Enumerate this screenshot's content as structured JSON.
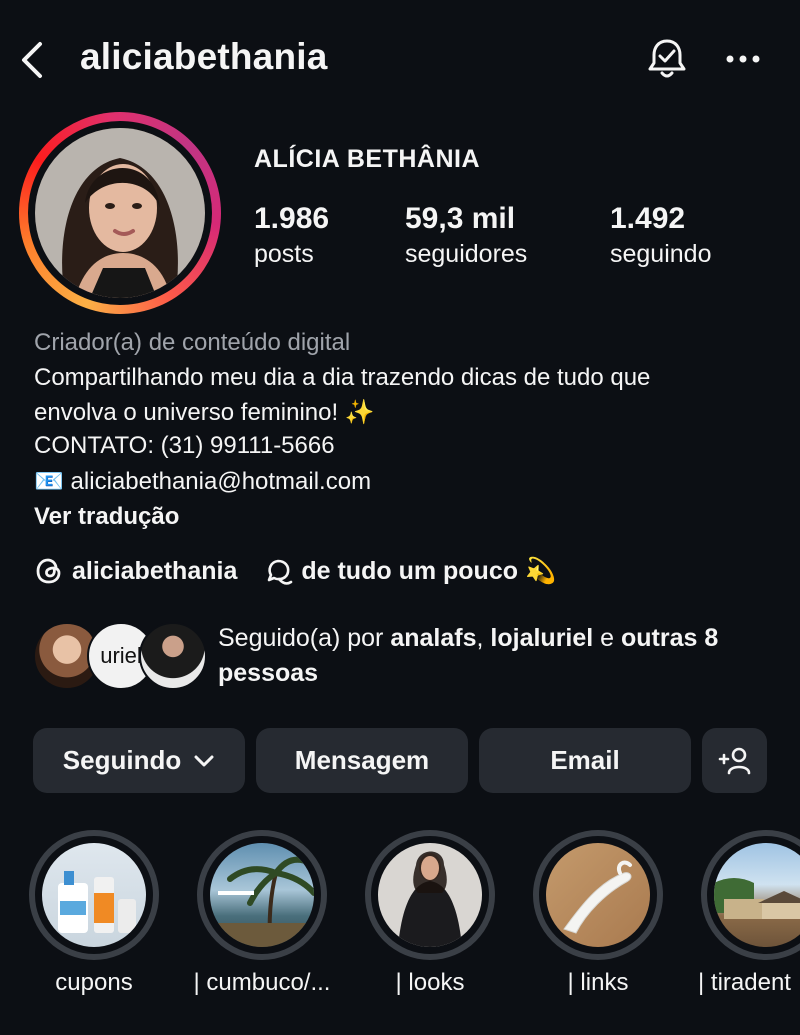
{
  "header": {
    "username": "aliciabethania"
  },
  "profile": {
    "full_name": "ALÍCIA BETHÂNIA",
    "stats": [
      {
        "value": "1.986",
        "label": "posts"
      },
      {
        "value": "59,3 mil",
        "label": "seguidores"
      },
      {
        "value": "1.492",
        "label": "seguindo"
      }
    ]
  },
  "bio": {
    "category": "Criador(a) de conteúdo digital",
    "line1": "Compartilhando meu dia a dia trazendo dicas de tudo que",
    "line2": "envolva o universo feminino! ✨",
    "line3": "CONTATO: (31) 99111-5666",
    "line4": "📧 aliciabethania@hotmail.com",
    "translate": "Ver tradução"
  },
  "links": {
    "threads_handle": "aliciabethania",
    "channel_name": "de tudo um pouco 💫"
  },
  "followed_by": {
    "prefix": "Seguido(a) por ",
    "name1": "analafs",
    "sep1": ", ",
    "name2": "lojaluriel",
    "sep2": " e ",
    "others": "outras 8 pessoas",
    "avatar_text_2": "uriel"
  },
  "actions": {
    "following": "Seguindo",
    "message": "Mensagem",
    "email": "Email"
  },
  "highlights": [
    {
      "label": "cupons"
    },
    {
      "label": "| cumbuco/..."
    },
    {
      "label": "| looks"
    },
    {
      "label": "| links"
    },
    {
      "label": "| tiradent"
    }
  ],
  "colors": {
    "background": "#0c0f14",
    "button": "#262a31",
    "secondary_text": "#a0a4ab"
  }
}
